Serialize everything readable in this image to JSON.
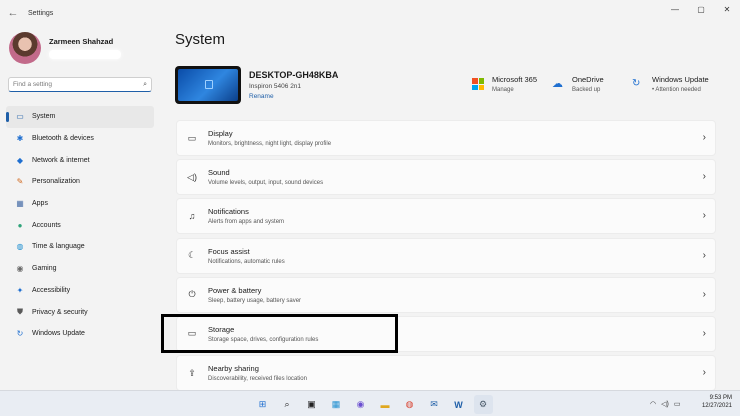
{
  "window": {
    "title": "Settings",
    "back_icon": "←",
    "minimize_icon": "—",
    "maximize_icon": "▢",
    "close_icon": "✕"
  },
  "profile": {
    "name": "Zarmeen Shahzad"
  },
  "search": {
    "placeholder": "Find a setting",
    "icon": "⌕"
  },
  "sidebar": {
    "items": [
      {
        "label": "System",
        "icon": "▭",
        "color": "#1f5fa8",
        "active": true
      },
      {
        "label": "Bluetooth & devices",
        "icon": "✱",
        "color": "#1f6fd0"
      },
      {
        "label": "Network & internet",
        "icon": "◆",
        "color": "#1f6fd0"
      },
      {
        "label": "Personalization",
        "icon": "✎",
        "color": "#d1691f"
      },
      {
        "label": "Apps",
        "icon": "▦",
        "color": "#4a6fa8"
      },
      {
        "label": "Accounts",
        "icon": "●",
        "color": "#2fa37a"
      },
      {
        "label": "Time & language",
        "icon": "◍",
        "color": "#1f8fd0"
      },
      {
        "label": "Gaming",
        "icon": "◉",
        "color": "#6a6a6a"
      },
      {
        "label": "Accessibility",
        "icon": "✦",
        "color": "#1f6fd0"
      },
      {
        "label": "Privacy & security",
        "icon": "⛊",
        "color": "#5a5a5a"
      },
      {
        "label": "Windows Update",
        "icon": "↻",
        "color": "#1f6fd0"
      }
    ]
  },
  "main": {
    "title": "System",
    "device": {
      "name": "DESKTOP-GH48KBA",
      "model": "Inspiron 5406 2n1",
      "rename": "Rename"
    },
    "tiles": [
      {
        "name": "Microsoft 365",
        "status": "Manage"
      },
      {
        "name": "OneDrive",
        "status": "Backed up"
      },
      {
        "name": "Windows Update",
        "status": "• Attention needed"
      }
    ],
    "cards": [
      {
        "title": "Display",
        "subtitle": "Monitors, brightness, night light, display profile",
        "icon": "▭"
      },
      {
        "title": "Sound",
        "subtitle": "Volume levels, output, input, sound devices",
        "icon": "◁)"
      },
      {
        "title": "Notifications",
        "subtitle": "Alerts from apps and system",
        "icon": "♫"
      },
      {
        "title": "Focus assist",
        "subtitle": "Notifications, automatic rules",
        "icon": "☾"
      },
      {
        "title": "Power & battery",
        "subtitle": "Sleep, battery usage, battery saver",
        "icon": "⏻"
      },
      {
        "title": "Storage",
        "subtitle": "Storage space, drives, configuration rules",
        "icon": "▭"
      },
      {
        "title": "Nearby sharing",
        "subtitle": "Discoverability, received files location",
        "icon": "⇪"
      }
    ],
    "chevron": "›"
  },
  "taskbar": {
    "apps": [
      {
        "name": "start",
        "glyph": "⊞",
        "color": "#1f6fd0"
      },
      {
        "name": "search",
        "glyph": "⌕",
        "color": "#222"
      },
      {
        "name": "task-view",
        "glyph": "▣",
        "color": "#222"
      },
      {
        "name": "widgets",
        "glyph": "▦",
        "color": "#1f8fd0"
      },
      {
        "name": "chat",
        "glyph": "◉",
        "color": "#6b4fd0"
      },
      {
        "name": "file-explorer",
        "glyph": "▬",
        "color": "#e0a81f"
      },
      {
        "name": "chrome",
        "glyph": "◍",
        "color": "#d9412f"
      },
      {
        "name": "outlook",
        "glyph": "✉",
        "color": "#1f5fa8"
      },
      {
        "name": "word",
        "glyph": "W",
        "color": "#1f5fa8"
      },
      {
        "name": "settings",
        "glyph": "⚙",
        "color": "#4a5a6a",
        "active": true
      }
    ],
    "tray": {
      "wifi": "◠",
      "volume": "◁)",
      "battery": "▭"
    },
    "time": "9:53 PM",
    "date": "12/27/2021"
  }
}
